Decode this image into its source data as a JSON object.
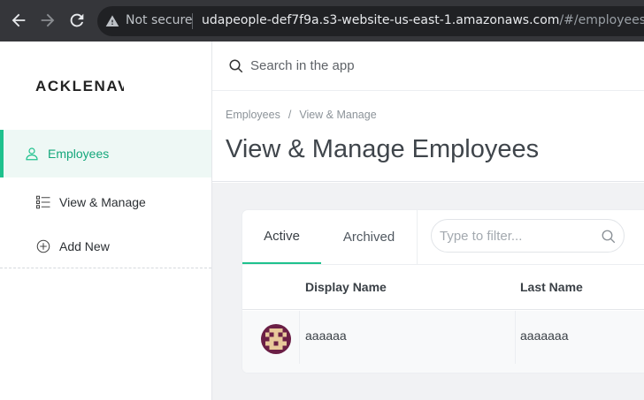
{
  "browser": {
    "security_label": "Not secure",
    "url_host": "udapeople-def7f9a.s3-website-us-east-1.amazonaws.com",
    "url_path": "/#/employees"
  },
  "sidebar": {
    "logo_text": "ACKLENAV",
    "items": [
      {
        "label": "Employees",
        "icon": "user-icon",
        "active": true
      },
      {
        "label": "View & Manage",
        "icon": "list-icon",
        "active": false
      },
      {
        "label": "Add New",
        "icon": "plus-circle-icon",
        "active": false
      }
    ]
  },
  "search": {
    "placeholder": "Search in the app"
  },
  "breadcrumb": {
    "items": [
      "Employees",
      "View & Manage"
    ]
  },
  "page": {
    "title": "View & Manage Employees"
  },
  "tabs": [
    {
      "label": "Active",
      "active": true
    },
    {
      "label": "Archived",
      "active": false
    }
  ],
  "filter": {
    "placeholder": "Type to filter..."
  },
  "table": {
    "columns": [
      "Display Name",
      "Last Name"
    ],
    "rows": [
      {
        "display_name": "aaaaaa",
        "last_name": "aaaaaaa"
      }
    ]
  },
  "colors": {
    "accent": "#1ec18d",
    "browser_chrome": "#35363a",
    "content_bg": "#f1f2f4",
    "avatar_bg": "#6b1f45",
    "avatar_pattern": "#e8c99a"
  }
}
